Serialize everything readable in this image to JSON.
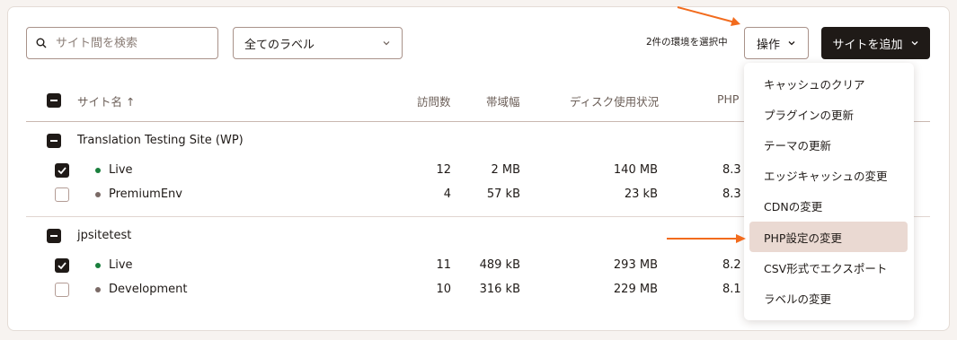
{
  "toolbar": {
    "search_placeholder": "サイト間を検索",
    "label_filter": "全てのラベル",
    "selected_count": "2件の環境を選択中",
    "operations_label": "操作",
    "add_site_label": "サイトを追加"
  },
  "table": {
    "headers": {
      "site_name": "サイト名 ↑",
      "visits": "訪問数",
      "bandwidth": "帯域幅",
      "disk_usage": "ディスク使用状況",
      "php": "PHP"
    },
    "groups": [
      {
        "name": "Translation Testing Site (WP)",
        "envs": [
          {
            "name": "Live",
            "visits": "12",
            "bandwidth": "2 MB",
            "disk": "140 MB",
            "php": "8.3",
            "checked": true,
            "status_color": "#1a7f3c"
          },
          {
            "name": "PremiumEnv",
            "visits": "4",
            "bandwidth": "57 kB",
            "disk": "23 kB",
            "php": "8.3",
            "checked": false,
            "status_color": "#7a6a66"
          }
        ]
      },
      {
        "name": "jpsitetest",
        "envs": [
          {
            "name": "Live",
            "visits": "11",
            "bandwidth": "489 kB",
            "disk": "293 MB",
            "php": "8.2",
            "checked": true,
            "status_color": "#1a7f3c"
          },
          {
            "name": "Development",
            "visits": "10",
            "bandwidth": "316 kB",
            "disk": "229 MB",
            "php": "8.1",
            "checked": false,
            "status_color": "#7a6a66"
          }
        ]
      }
    ]
  },
  "menu": {
    "items": [
      "キャッシュのクリア",
      "プラグインの更新",
      "テーマの更新",
      "エッジキャッシュの変更",
      "CDNの変更",
      "PHP設定の変更",
      "CSV形式でエクスポート",
      "ラベルの変更"
    ],
    "highlighted": "PHP設定の変更"
  },
  "colors": {
    "accent_dark": "#1f1a17",
    "annotation_arrow": "#f26b1d",
    "highlight": "#ead9d2"
  }
}
